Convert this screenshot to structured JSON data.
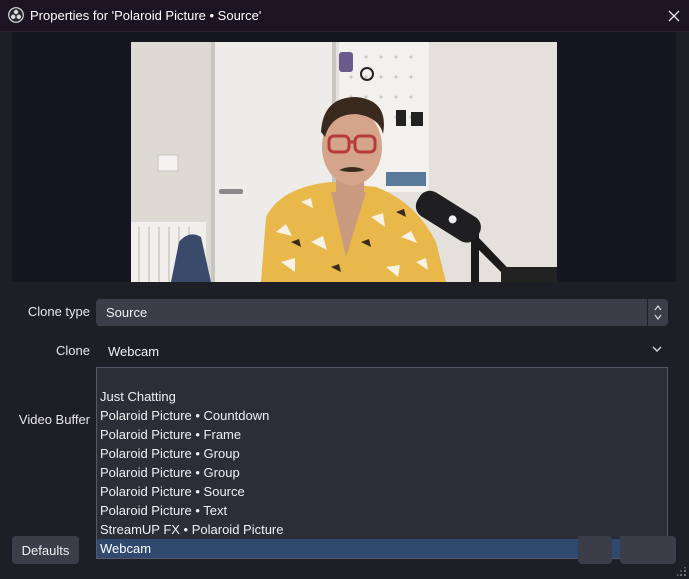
{
  "window": {
    "title": "Properties for 'Polaroid Picture • Source'"
  },
  "preview": {
    "description_icon": "webcam-feed"
  },
  "form": {
    "clone_type": {
      "label": "Clone type",
      "value": "Source"
    },
    "clone": {
      "label": "Clone",
      "value": "Webcam"
    },
    "video_buffer": {
      "label": "Video Buffer"
    }
  },
  "dropdown": {
    "items": [
      {
        "label": ""
      },
      {
        "label": "Just Chatting"
      },
      {
        "label": "Polaroid Picture • Countdown"
      },
      {
        "label": "Polaroid Picture • Frame"
      },
      {
        "label": "Polaroid Picture • Group"
      },
      {
        "label": "Polaroid Picture • Group"
      },
      {
        "label": "Polaroid Picture • Source"
      },
      {
        "label": "Polaroid Picture • Text"
      },
      {
        "label": "StreamUP FX • Polaroid Picture"
      },
      {
        "label": "Webcam"
      }
    ],
    "selected_index": 9
  },
  "buttons": {
    "defaults": "Defaults"
  },
  "colors": {
    "background": "#1e1e26",
    "titlebar": "#1b1422",
    "control": "#3b3d49",
    "selection": "#2f4a6e"
  }
}
